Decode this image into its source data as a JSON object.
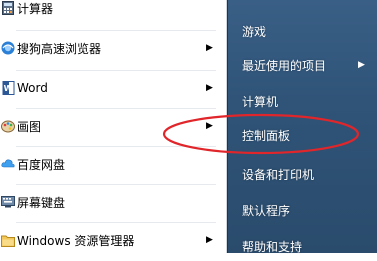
{
  "left_menu": {
    "items": [
      {
        "label": "计算器",
        "icon": "calculator-icon",
        "has_submenu": false
      },
      {
        "label": "搜狗高速浏览器",
        "icon": "sogou-browser-icon",
        "has_submenu": true
      },
      {
        "label": "Word",
        "icon": "word-icon",
        "has_submenu": true
      },
      {
        "label": "画图",
        "icon": "paint-icon",
        "has_submenu": true
      },
      {
        "label": "百度网盘",
        "icon": "baidu-netdisk-icon",
        "has_submenu": false
      },
      {
        "label": "屏幕键盘",
        "icon": "onscreen-keyboard-icon",
        "has_submenu": false
      },
      {
        "label": "Windows 资源管理器",
        "icon": "windows-explorer-icon",
        "has_submenu": true
      }
    ],
    "submenu_arrow": "▶"
  },
  "right_menu": {
    "items": [
      {
        "label": "游戏",
        "has_submenu": false
      },
      {
        "label": "最近使用的项目",
        "has_submenu": true
      },
      {
        "label": "计算机",
        "has_submenu": false
      },
      {
        "label": "控制面板",
        "has_submenu": false,
        "highlighted": true
      },
      {
        "label": "设备和打印机",
        "has_submenu": false
      },
      {
        "label": "默认程序",
        "has_submenu": false
      },
      {
        "label": "帮助和支持",
        "has_submenu": false
      }
    ],
    "submenu_arrow": "▶"
  },
  "annotation": {
    "color": "#e0262a"
  }
}
